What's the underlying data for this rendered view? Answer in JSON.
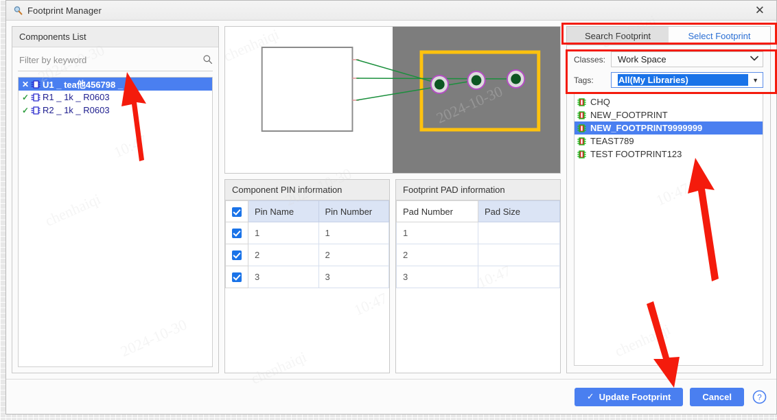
{
  "window": {
    "title": "Footprint Manager",
    "title_icon": "magnifier-icon",
    "close_label": "✕"
  },
  "components_panel": {
    "header": "Components List",
    "filter": {
      "placeholder": "Filter by keyword",
      "value": "",
      "icon": "search-icon"
    },
    "items": [
      {
        "mark": "✕",
        "mark_type": "cross",
        "label": "U1 _ tea他456798 _",
        "selected": true
      },
      {
        "mark": "✓",
        "mark_type": "check",
        "label": "R1 _ 1k _ R0603",
        "selected": false
      },
      {
        "mark": "✓",
        "mark_type": "check",
        "label": "R2 _ 1k _ R0603",
        "selected": false
      }
    ]
  },
  "pin_table": {
    "header": "Component PIN information",
    "columns": [
      "Pin Name",
      "Pin Number"
    ],
    "header_checked": true,
    "rows": [
      {
        "checked": true,
        "pin_name": "1",
        "pin_number": "1"
      },
      {
        "checked": true,
        "pin_name": "2",
        "pin_number": "2"
      },
      {
        "checked": true,
        "pin_name": "3",
        "pin_number": "3"
      }
    ]
  },
  "pad_table": {
    "header": "Footprint PAD information",
    "columns": [
      "Pad Number",
      "Pad Size"
    ],
    "rows": [
      {
        "pad_number": "1",
        "pad_size": ""
      },
      {
        "pad_number": "2",
        "pad_size": ""
      },
      {
        "pad_number": "3",
        "pad_size": ""
      }
    ]
  },
  "right_panel": {
    "tabs": [
      {
        "label": "Search Footprint",
        "active": true
      },
      {
        "label": "Select Footprint",
        "active": false
      }
    ],
    "classes": {
      "label": "Classes:",
      "value": "Work Space"
    },
    "tags": {
      "label": "Tags:",
      "value": "All(My Libraries)",
      "highlighted": true
    },
    "footprints": [
      {
        "label": "CHQ",
        "selected": false
      },
      {
        "label": "NEW_FOOTPRINT",
        "selected": false
      },
      {
        "label": "NEW_FOOTPRINT9999999",
        "selected": true
      },
      {
        "label": "TEAST789",
        "selected": false
      },
      {
        "label": "TEST FOOTPRINT123",
        "selected": false
      }
    ]
  },
  "footer": {
    "update_label": "Update Footprint",
    "update_icon": "check-icon",
    "cancel_label": "Cancel",
    "help_icon": "help-circle-icon"
  },
  "colors": {
    "accent_blue": "#4a7ff0",
    "selection_blue": "#1a73e8",
    "annotation_red": "#f41b0c",
    "footprint_outline": "#ffc20e",
    "pad_ring": "#b44ec4",
    "ratline_green": "#1a8f3c",
    "canvas_gray": "#7d7d7d"
  }
}
